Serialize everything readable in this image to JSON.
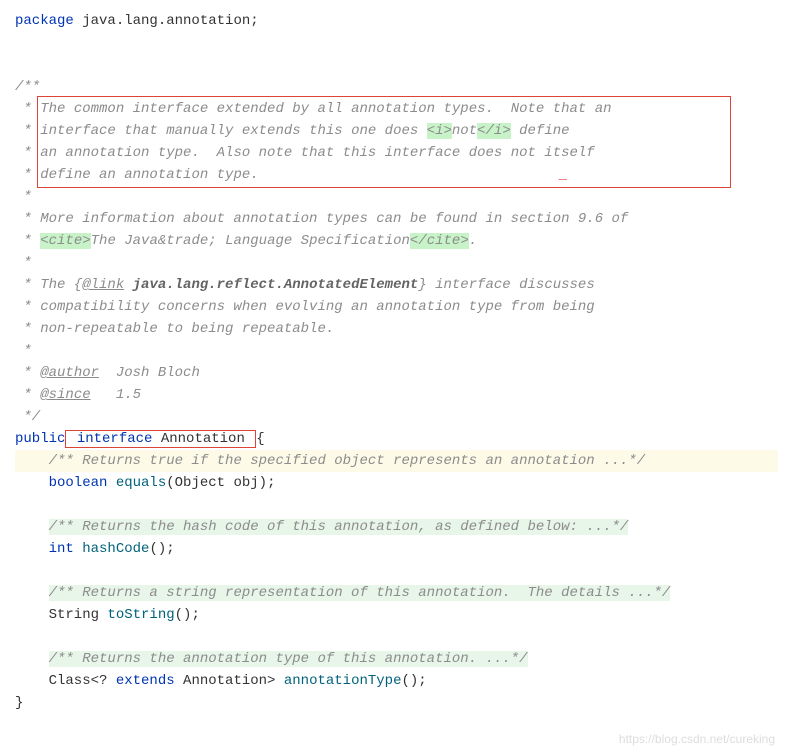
{
  "code": {
    "package_kw": "package",
    "package_name": " java.lang.annotation;",
    "doc_open": "/**",
    "doc_l1a": " * ",
    "doc_l1b": "The common interface extended by all annotation types.  Note that an",
    "doc_l2a": " * ",
    "doc_l2b": "interface that manually extends this one does ",
    "doc_l2_tag1": "<i>",
    "doc_l2_not": "not",
    "doc_l2_tag2": "</i>",
    "doc_l2c": " define",
    "doc_l3a": " * ",
    "doc_l3b": "an annotation type.  Also note that this interface does not itself",
    "doc_l4a": " * ",
    "doc_l4b": "define an annotation type.",
    "doc_l4_underscore": "_",
    "doc_star": " *",
    "doc_l6a": " * More information about annotation types can be found in section 9.6 of",
    "doc_l7a": " * ",
    "doc_l7_tag1": "<cite>",
    "doc_l7b": "The Java&trade; Language Specification",
    "doc_l7_tag2": "</cite>",
    "doc_l7c": ".",
    "doc_l9a": " * The {",
    "doc_l9_tag": "@link",
    "doc_l9b": " ",
    "doc_l9_bold": "java.lang.reflect.AnnotatedElement",
    "doc_l9c": "} interface discusses",
    "doc_l10": " * compatibility concerns when evolving an annotation type from being",
    "doc_l11": " * non-repeatable to being repeatable.",
    "doc_l13a": " * ",
    "doc_author": "@author",
    "doc_l13b": "  Josh Bloch",
    "doc_l14a": " * ",
    "doc_since": "@since",
    "doc_l14b": "   1.5",
    "doc_close": " */",
    "public_kw": "public",
    "interface_kw": " interface ",
    "interface_name": "Annotation ",
    "brace_open": "{",
    "m1_doc": "/** Returns true if the specified object represents an annotation ...*/",
    "m1_ret": "    boolean ",
    "m1_name": "equals",
    "m1_params": "(Object obj);",
    "m2_doc": "/** Returns the hash code of this annotation, as defined below: ...*/",
    "m2_ret": "    int ",
    "m2_name": "hashCode",
    "m2_params": "();",
    "m3_doc": "/** Returns a string representation of this annotation.  The details ...*/",
    "m3_ret": "    String ",
    "m3_name": "toString",
    "m3_params": "();",
    "m4_doc": "/** Returns the annotation type of this annotation. ...*/",
    "m4_ret1": "    Class<? ",
    "m4_extends": "extends",
    "m4_ret2": " Annotation> ",
    "m4_name": "annotationType",
    "m4_params": "();",
    "brace_close": "}",
    "indent4": "    "
  },
  "watermark": "https://blog.csdn.net/cureking"
}
